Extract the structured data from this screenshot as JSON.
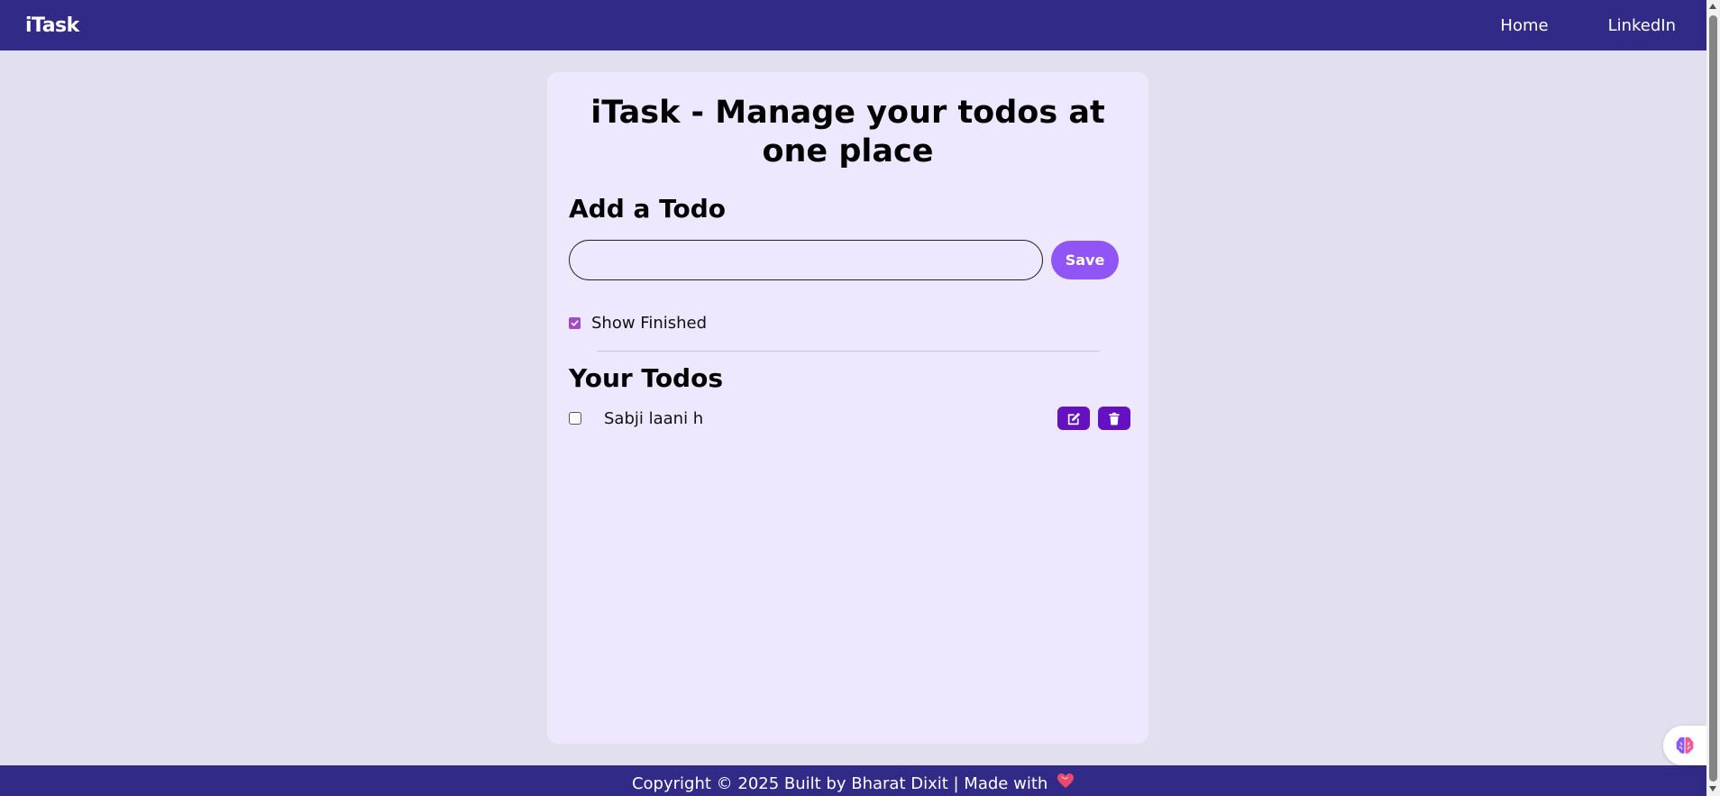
{
  "navbar": {
    "brand": "iTask",
    "links": [
      {
        "label": "Home"
      },
      {
        "label": "LinkedIn"
      }
    ]
  },
  "main": {
    "title": "iTask - Manage your todos at one place",
    "add_section": {
      "title": "Add a Todo",
      "input_value": "",
      "save_label": "Save"
    },
    "show_finished": {
      "label": "Show Finished",
      "checked": true
    },
    "todos_section": {
      "title": "Your Todos",
      "items": [
        {
          "text": "Sabji laani h",
          "done": false
        }
      ]
    }
  },
  "footer": {
    "text": "Copyright © 2025 Built by Bharat Dixit | Made with"
  },
  "icons": {
    "edit": "edit-icon",
    "delete": "trash-icon",
    "heart": "heart-icon",
    "widget": "brain-icon"
  },
  "colors": {
    "navbar": "#312b87",
    "page_bg": "#e2e0ee",
    "card_bg": "#ede8fd",
    "save_button": "#9155f5",
    "action_button": "#6311c1",
    "checkbox_checked": "#a14bc6"
  }
}
